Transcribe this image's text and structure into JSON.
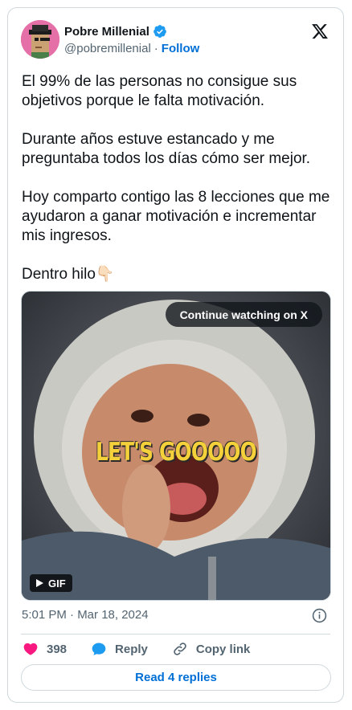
{
  "author": {
    "name": "Pobre Millenial",
    "handle": "@pobremillenial",
    "separator": "·",
    "follow_label": "Follow"
  },
  "tweet": {
    "paragraphs": [
      "El 99% de las personas no consigue sus objetivos porque le falta motivación.",
      "Durante años estuve estancado y me preguntaba todos los días cómo ser mejor.",
      "Hoy comparto contigo las 8 lecciones que me ayudaron a ganar motivación e incrementar mis ingresos.",
      "Dentro hilo👇🏻"
    ]
  },
  "media": {
    "continue_label": "Continue watching on X",
    "overlay_caption": "LET'S GOOOOO",
    "badge_label": "GIF"
  },
  "meta": {
    "timestamp": "5:01 PM · Mar 18, 2024"
  },
  "actions": {
    "like_count": "398",
    "reply_label": "Reply",
    "copy_label": "Copy link"
  },
  "footer": {
    "read_replies_label": "Read 4 replies"
  },
  "colors": {
    "accent": "#006fd6",
    "like": "#f91880",
    "verified": "#1d9bf0",
    "muted": "#536471",
    "border": "#cfd9de"
  },
  "icons": [
    "x-logo-icon",
    "verified-badge-icon",
    "heart-icon",
    "reply-bubble-icon",
    "link-icon",
    "info-icon",
    "play-icon"
  ]
}
